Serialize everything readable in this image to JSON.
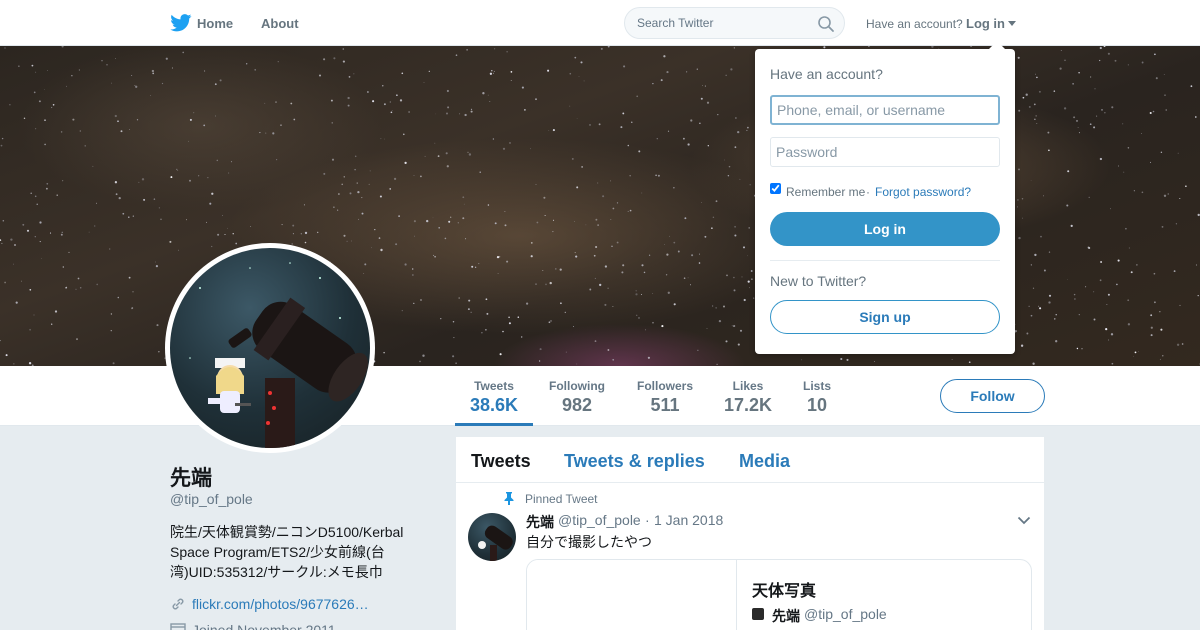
{
  "nav": {
    "home_label": "Home",
    "about_label": "About",
    "search_placeholder": "Search Twitter",
    "have_account_label": "Have an account?",
    "login_label": "Log in"
  },
  "profile": {
    "name": "先端",
    "handle": "@tip_of_pole",
    "bio": "院生/天体観賞勢/ニコンD5100/Kerbal Space Program/ETS2/少女前線(台湾)UID:535312/サークル:メモ長巾",
    "link": "flickr.com/photos/9677626…",
    "joined": "Joined November 2011"
  },
  "stats": [
    {
      "label": "Tweets",
      "value": "38.6K"
    },
    {
      "label": "Following",
      "value": "982"
    },
    {
      "label": "Followers",
      "value": "511"
    },
    {
      "label": "Likes",
      "value": "17.2K"
    },
    {
      "label": "Lists",
      "value": "10"
    }
  ],
  "follow_label": "Follow",
  "timeline": {
    "tabs": [
      "Tweets",
      "Tweets & replies",
      "Media"
    ],
    "pinned_label": "Pinned Tweet",
    "tweet": {
      "name": "先端",
      "handle": "@tip_of_pole",
      "separator": "·",
      "date": "1 Jan 2018",
      "text": "自分で撮影したやつ",
      "card_title": "天体写真",
      "card_author": "先端",
      "card_handle": "@tip_of_pole"
    }
  },
  "login_dropdown": {
    "title": "Have an account?",
    "username_placeholder": "Phone, email, or username",
    "password_placeholder": "Password",
    "remember_label": "Remember me",
    "separator": "·",
    "forgot_label": "Forgot password?",
    "login_button": "Log in",
    "new_label": "New to Twitter?",
    "signup_button": "Sign up"
  },
  "colors": {
    "link": "#2b7bb9",
    "button": "#3394c8",
    "muted": "#657786"
  }
}
